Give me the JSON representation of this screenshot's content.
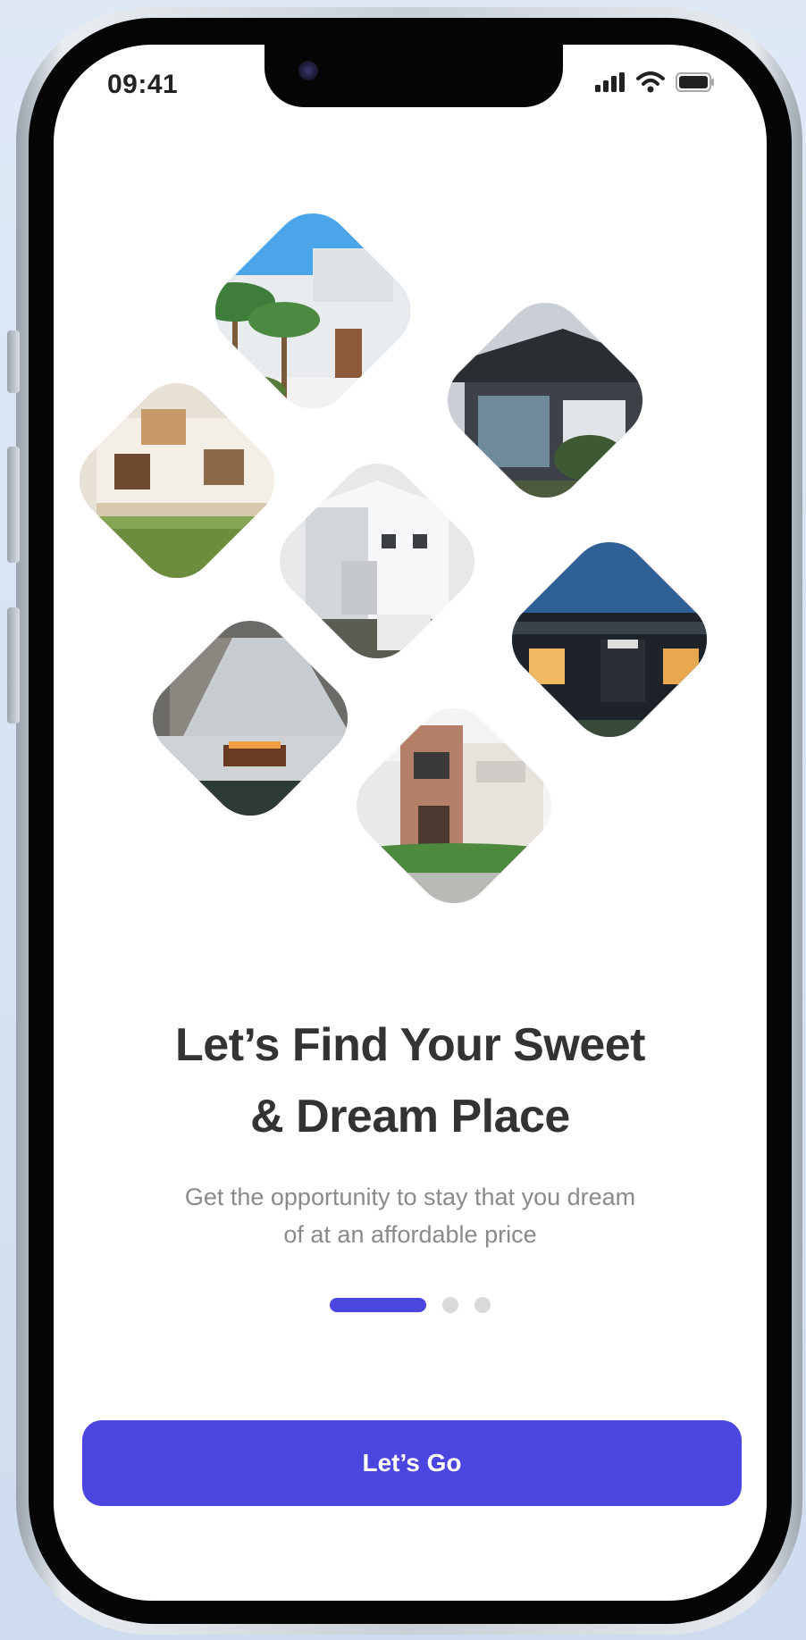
{
  "status_bar": {
    "time": "09:41",
    "icons": [
      "signal-icon",
      "wifi-icon",
      "battery-icon"
    ]
  },
  "gallery": {
    "tiles": [
      {
        "name": "house-tile-palms"
      },
      {
        "name": "house-tile-dark-modern"
      },
      {
        "name": "house-tile-lawn"
      },
      {
        "name": "house-tile-white-modern"
      },
      {
        "name": "house-tile-night-facade"
      },
      {
        "name": "house-tile-living-room"
      },
      {
        "name": "house-tile-brick-townhouse"
      }
    ]
  },
  "onboarding": {
    "headline_line1": "Let’s Find Your Sweet",
    "headline_line2": "& Dream Place",
    "subtitle_line1": "Get the opportunity to stay that you dream",
    "subtitle_line2": "of at an affordable price",
    "page_count": 3,
    "active_page": 1
  },
  "cta": {
    "label": "Let’s Go"
  },
  "colors": {
    "accent": "#4b46e0",
    "headline": "#333333",
    "subtitle": "#8a8a8a",
    "dot_inactive": "#dadada"
  }
}
